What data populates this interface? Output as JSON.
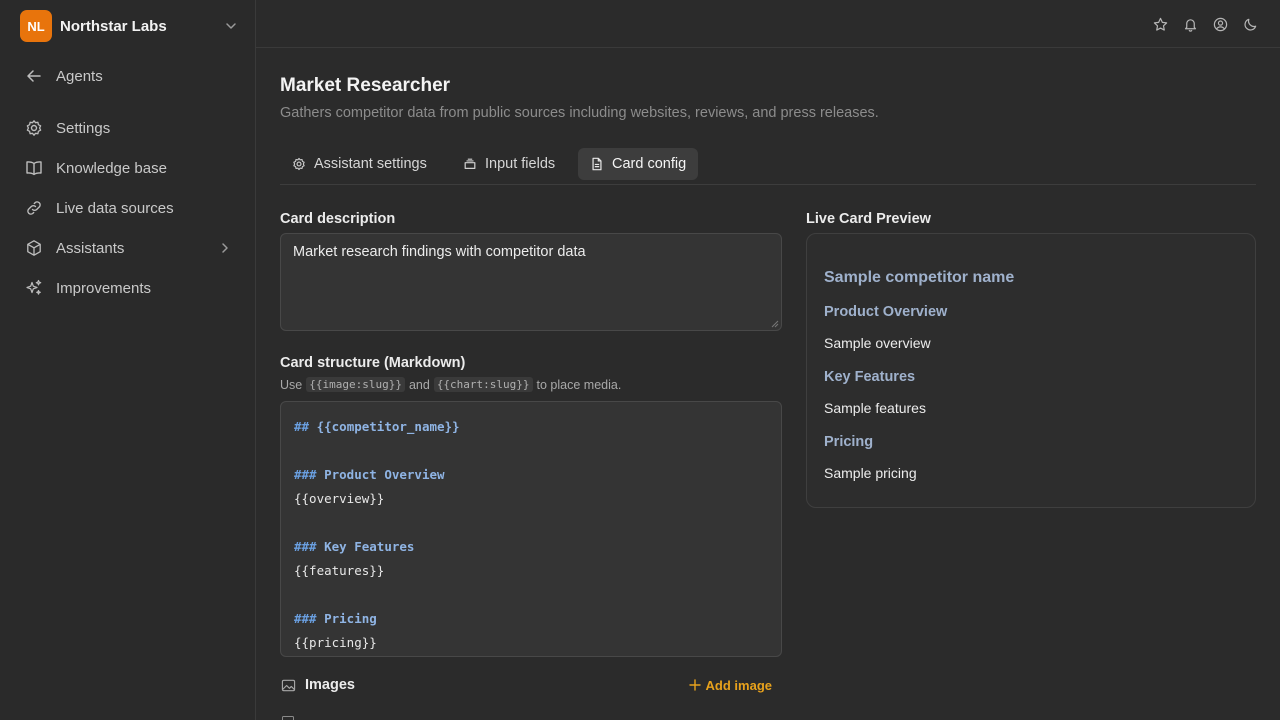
{
  "org": {
    "initials": "NL",
    "name": "Northstar Labs"
  },
  "sidebar": {
    "items": [
      {
        "label": "Agents"
      },
      {
        "label": "Settings"
      },
      {
        "label": "Knowledge base"
      },
      {
        "label": "Live data sources"
      },
      {
        "label": "Assistants"
      },
      {
        "label": "Improvements"
      }
    ]
  },
  "topbar": {
    "icons": [
      "star-icon",
      "bell-icon",
      "user-circle-icon",
      "moon-icon"
    ]
  },
  "page": {
    "title": "Market Researcher",
    "subtitle": "Gathers competitor data from public sources including websites, reviews, and press releases."
  },
  "tabs": [
    {
      "label": "Assistant settings",
      "icon": "gear-icon"
    },
    {
      "label": "Input fields",
      "icon": "stack-icon"
    },
    {
      "label": "Card config",
      "icon": "document-icon",
      "active": true
    }
  ],
  "card_description": {
    "label": "Card description",
    "value": "Market research findings with competitor data"
  },
  "card_structure": {
    "label": "Card structure (Markdown)",
    "hint_prefix": "Use",
    "hint_code1": "{{image:slug}}",
    "hint_mid": "and",
    "hint_code2": "{{chart:slug}}",
    "hint_suffix": "to place media.",
    "lines": [
      {
        "hash": "##",
        "text": "{{competitor_name}}"
      },
      {
        "hash": "###",
        "text": "Product Overview"
      },
      {
        "text": "{{overview}}"
      },
      {
        "hash": "###",
        "text": "Key Features"
      },
      {
        "text": "{{features}}"
      },
      {
        "hash": "###",
        "text": "Pricing"
      },
      {
        "text": "{{pricing}}"
      }
    ]
  },
  "images": {
    "label": "Images",
    "add_label": "Add image"
  },
  "preview": {
    "label": "Live Card Preview",
    "title": "Sample competitor name",
    "sections": [
      {
        "heading": "Product Overview",
        "body": "Sample overview"
      },
      {
        "heading": "Key Features",
        "body": "Sample features"
      },
      {
        "heading": "Pricing",
        "body": "Sample pricing"
      }
    ]
  },
  "colors": {
    "accent": "#e8740c",
    "add_link": "#e8a21c",
    "md_heading": "#8fb4e4",
    "preview_heading": "#9fb1cc"
  }
}
